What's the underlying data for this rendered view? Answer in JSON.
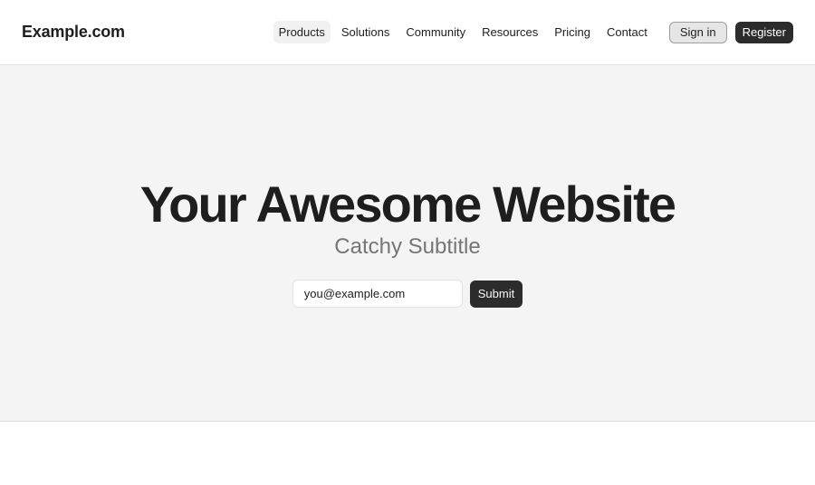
{
  "header": {
    "logo": "Example.com",
    "nav": [
      {
        "label": "Products",
        "active": true
      },
      {
        "label": "Solutions",
        "active": false
      },
      {
        "label": "Community",
        "active": false
      },
      {
        "label": "Resources",
        "active": false
      },
      {
        "label": "Pricing",
        "active": false
      },
      {
        "label": "Contact",
        "active": false
      }
    ],
    "sign_in_label": "Sign in",
    "register_label": "Register"
  },
  "hero": {
    "title": "Your Awesome Website",
    "subtitle": "Catchy Subtitle",
    "email_value": "you@example.com",
    "submit_label": "Submit"
  },
  "colors": {
    "primary_dark": "#2c2c2c",
    "hero_background": "#f4f4f4",
    "subtitle_gray": "#757575"
  }
}
